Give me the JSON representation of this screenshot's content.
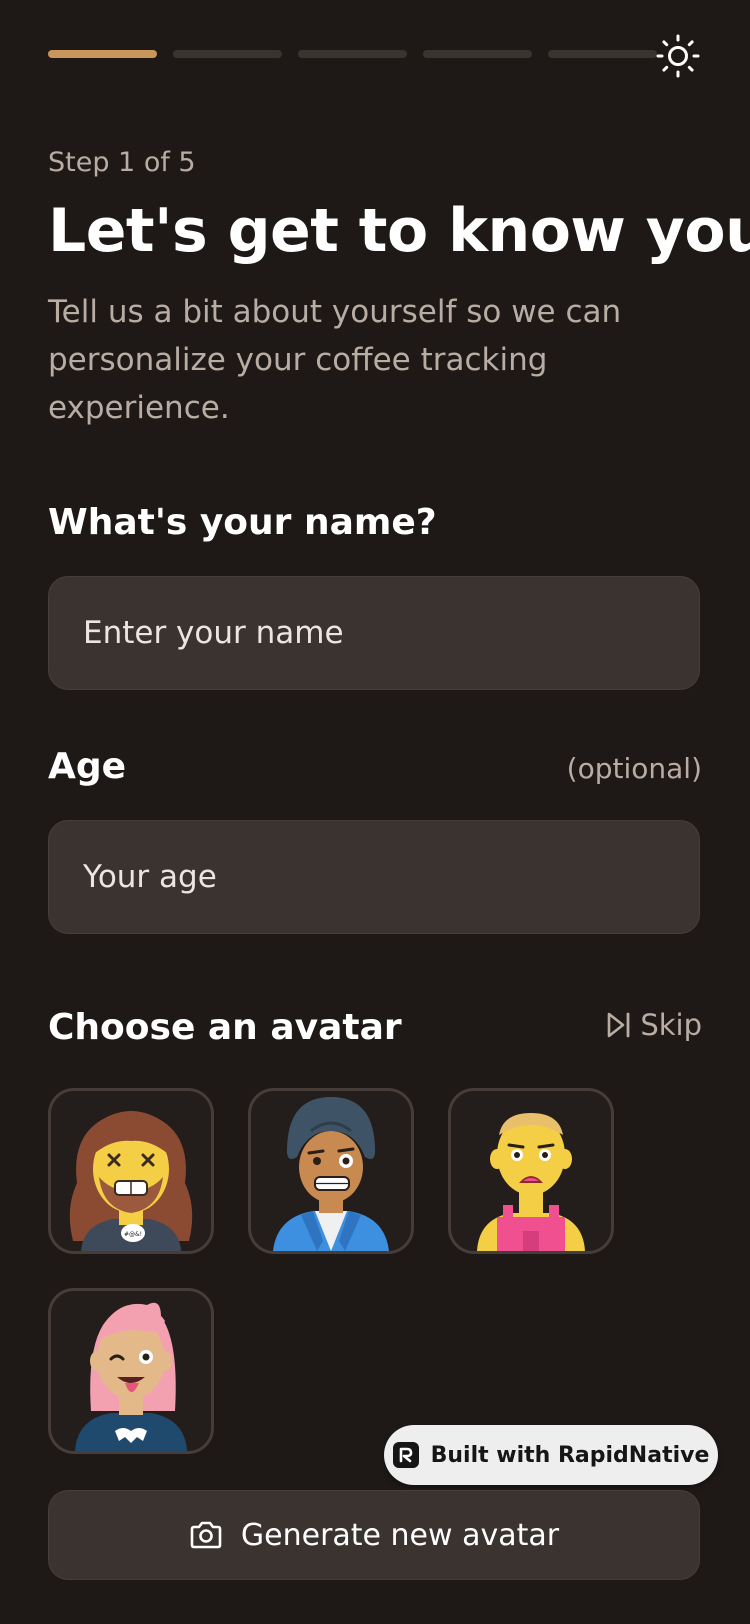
{
  "progress": {
    "total_steps": 5,
    "current_step": 1
  },
  "theme_toggle": {
    "icon": "sun-icon"
  },
  "header": {
    "step_text": "Step 1 of 5",
    "title": "Let's get to know you",
    "subtitle": "Tell us a bit about yourself so we can personalize your coffee tracking experience."
  },
  "name_field": {
    "label": "What's your name?",
    "placeholder": "Enter your name",
    "value": ""
  },
  "age_field": {
    "label": "Age",
    "optional_text": "(optional)",
    "placeholder": "Your age",
    "value": ""
  },
  "avatar_section": {
    "label": "Choose an avatar",
    "skip_label": "Skip",
    "skip_icon": "skip-forward-icon",
    "avatars": [
      {
        "name": "avatar-long-hair-bearded",
        "speech_text": "#@&!"
      },
      {
        "name": "avatar-turban-blazer"
      },
      {
        "name": "avatar-bald-overalls"
      },
      {
        "name": "avatar-pink-hair-wink"
      }
    ]
  },
  "badge": {
    "label": "Built with RapidNative",
    "icon": "rapidnative-logo"
  },
  "generate_button": {
    "label": "Generate new avatar",
    "icon": "camera-icon"
  },
  "colors": {
    "background": "#1e1917",
    "accent": "#c8955a",
    "surface": "#3a3330",
    "muted_text": "#b8aca3"
  }
}
